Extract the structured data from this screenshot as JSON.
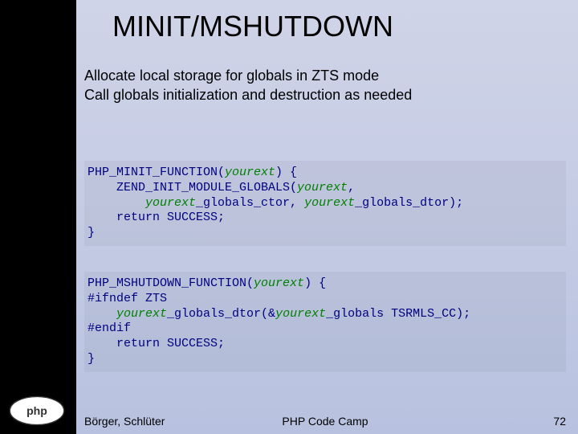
{
  "title": "MINIT/MSHUTDOWN",
  "bullets": {
    "check": "☑",
    "item1": "Allocate local storage for globals in ZTS mode",
    "item2": "Call globals initialization and destruction as needed"
  },
  "code1": {
    "l1a": "PHP_MINIT_FUNCTION(",
    "l1b": "yourext",
    "l1c": ") {",
    "l2a": "    ZEND_INIT_MODULE_GLOBALS(",
    "l2b": "yourext",
    "l2c": ",",
    "l3a": "        ",
    "l3b": "yourext",
    "l3c": "_globals_ctor, ",
    "l3d": "yourext",
    "l3e": "_globals_dtor);",
    "l4": "    return SUCCESS;",
    "l5": "}"
  },
  "code2": {
    "l1a": "PHP_MSHUTDOWN_FUNCTION(",
    "l1b": "yourext",
    "l1c": ") {",
    "l2": "#ifndef ZTS",
    "l3a": "    ",
    "l3b": "yourext",
    "l3c": "_globals_dtor(&",
    "l3d": "yourext",
    "l3e": "_globals TSRMLS_CC);",
    "l4": "#endif",
    "l5": "    return SUCCESS;",
    "l6": "}"
  },
  "footer": {
    "left": "Börger, Schlüter",
    "center": "PHP Code Camp",
    "right": "72"
  }
}
